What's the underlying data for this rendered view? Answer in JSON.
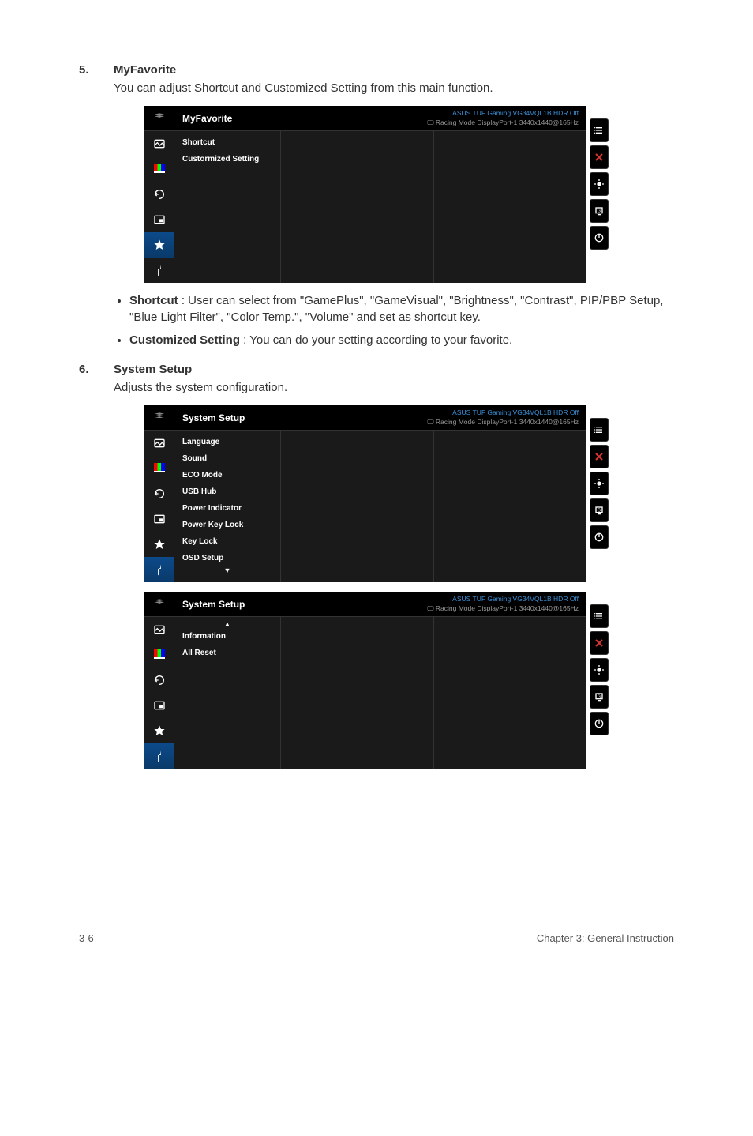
{
  "section5": {
    "num": "5.",
    "title": "MyFavorite",
    "desc": "You can adjust Shortcut and Customized Setting from this main function."
  },
  "osd1": {
    "title": "MyFavorite",
    "info1": "ASUS TUF Gaming VG34VQL1B  HDR Off",
    "info2": "Racing Mode DisplayPort-1 3440x1440@165Hz",
    "items": [
      "Shortcut",
      "Custormized Setting"
    ]
  },
  "bullets5": [
    {
      "lead": "Shortcut",
      "rest": " : User can select from \"GamePlus\", \"GameVisual\", \"Brightness\", \"Contrast\", PIP/PBP Setup, \"Blue Light Filter\", \"Color Temp.\", \"Volume\" and set as shortcut key."
    },
    {
      "lead": "Customized Setting",
      "rest": " : You can do your setting according to your favorite."
    }
  ],
  "section6": {
    "num": "6.",
    "title": "System Setup",
    "desc": "Adjusts the system configuration."
  },
  "osd2": {
    "title": "System Setup",
    "info1": "ASUS TUF Gaming VG34VQL1B  HDR Off",
    "info2": "Racing Mode DisplayPort-1 3440x1440@165Hz",
    "items": [
      "Language",
      "Sound",
      "ECO Mode",
      "USB Hub",
      "Power Indicator",
      "Power Key Lock",
      "Key Lock",
      "OSD Setup"
    ]
  },
  "osd3": {
    "title": "System Setup",
    "info1": "ASUS TUF Gaming VG34VQL1B  HDR Off",
    "info2": "Racing Mode DisplayPort-1 3440x1440@165Hz",
    "items": [
      "Information",
      "All Reset"
    ]
  },
  "footer": {
    "left": "3-6",
    "right": "Chapter 3: General Instruction"
  },
  "icons": {
    "monitor": "🖵"
  }
}
